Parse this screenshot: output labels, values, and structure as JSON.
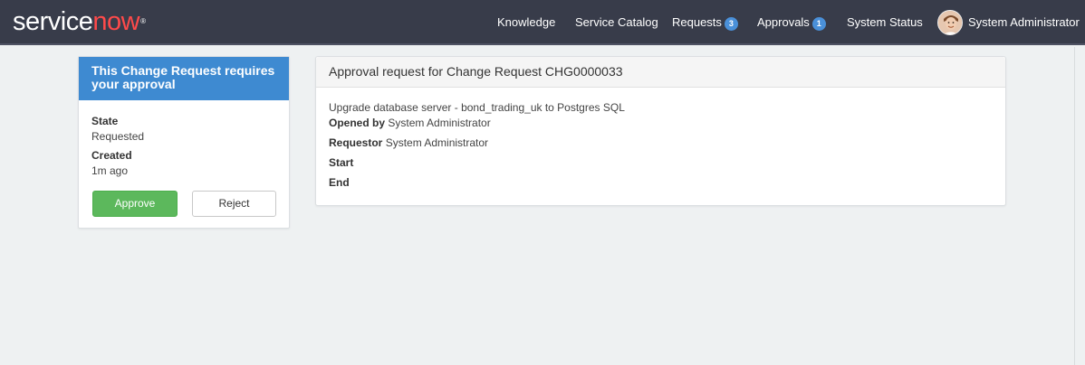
{
  "header": {
    "logo_service": "service",
    "logo_now": "now",
    "nav": [
      {
        "label": "Knowledge"
      },
      {
        "label": "Service Catalog"
      },
      {
        "label": "Requests",
        "badge": "3"
      },
      {
        "label": "Approvals",
        "badge": "1"
      },
      {
        "label": "System Status"
      }
    ],
    "user_name": "System Administrator"
  },
  "summary_card": {
    "title": "This Change Request requires your approval",
    "state_label": "State",
    "state_value": "Requested",
    "created_label": "Created",
    "created_value": "1m ago",
    "approve_label": "Approve",
    "reject_label": "Reject"
  },
  "detail_card": {
    "title": "Approval request for Change Request CHG0000033",
    "description": "Upgrade database server - bond_trading_uk to Postgres SQL",
    "opened_by_label": "Opened by",
    "opened_by_value": "System Administrator",
    "requestor_label": "Requestor",
    "requestor_value": "System Administrator",
    "start_label": "Start",
    "end_label": "End"
  },
  "colors": {
    "header_bg": "#383c4a",
    "card_header_blue": "#3e8ad1",
    "approve_green": "#5cb85c",
    "badge_blue": "#4a90d9",
    "logo_accent": "#ff4a4a"
  }
}
